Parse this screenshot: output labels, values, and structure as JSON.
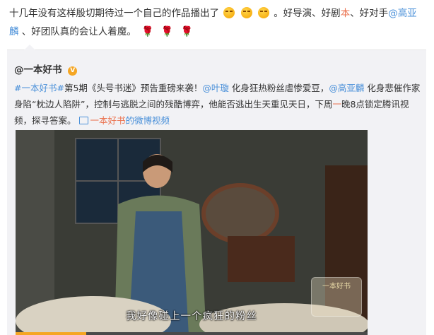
{
  "post": {
    "part1": "十几年没有这样殷切期待过一个自己的作品播出了",
    "part2": "。好导演、好剧",
    "part3": "本",
    "part4": "、好对手",
    "mention": "@高亚麟",
    "part5": "、好团队真的会让人着魔。"
  },
  "repost": {
    "author": "@一本好书",
    "hashtag1": "#一本好书#",
    "text1": "第5期《头号书迷》预告重磅来袭！",
    "mention1": "@叶璇",
    "text2": " 化身狂热粉丝虐惨爱豆，",
    "mention2": "@高亚麟",
    "text3": " 化身悲催作家身陷“枕边人陷阱”，控制与逃脱之间的残酷博弈，他能否逃出生天重见天日，下周",
    "text3b": "一",
    "text3c": "晚8点锁定腾讯视频，探寻答案。",
    "video_link_a": "一本好书",
    "video_link_b": "的微博视频"
  },
  "video": {
    "subtitle": "我好像碰上一个疯狂的粉丝",
    "watermark": "一本好书",
    "progress": 0.2
  },
  "colors": {
    "link_orange": "#eb7350",
    "link_blue": "#4a90d9",
    "card_bg": "#f2f2f5"
  }
}
